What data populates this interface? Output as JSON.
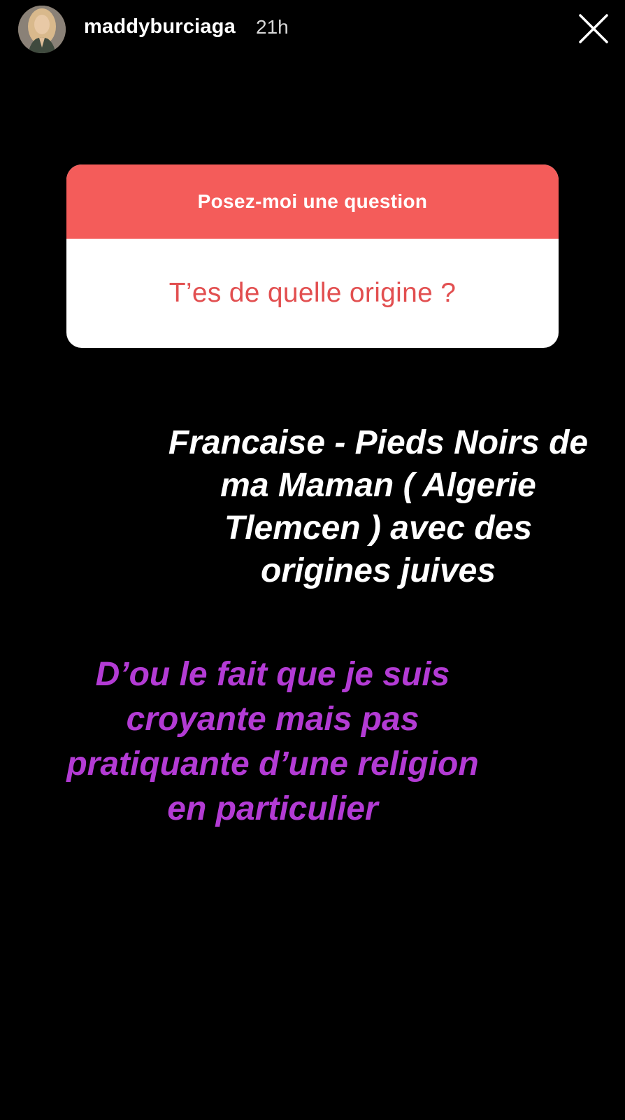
{
  "header": {
    "username": "maddyburciaga",
    "timestamp": "21h"
  },
  "question_card": {
    "prompt": "Posez-moi une question",
    "question": "T’es de quelle origine ?",
    "header_color": "#f45c5a",
    "question_color": "#e24f50"
  },
  "answer": {
    "white_text": "Francaise - Pieds Noirs de ma Maman ( Algerie Tlemcen ) avec des origines juives",
    "purple_text": "D’ou le fait que je suis croyante mais pas pratiquante d’une religion en particulier",
    "purple_color": "#b33bd4"
  },
  "icons": {
    "close": "close-icon",
    "avatar": "avatar"
  }
}
